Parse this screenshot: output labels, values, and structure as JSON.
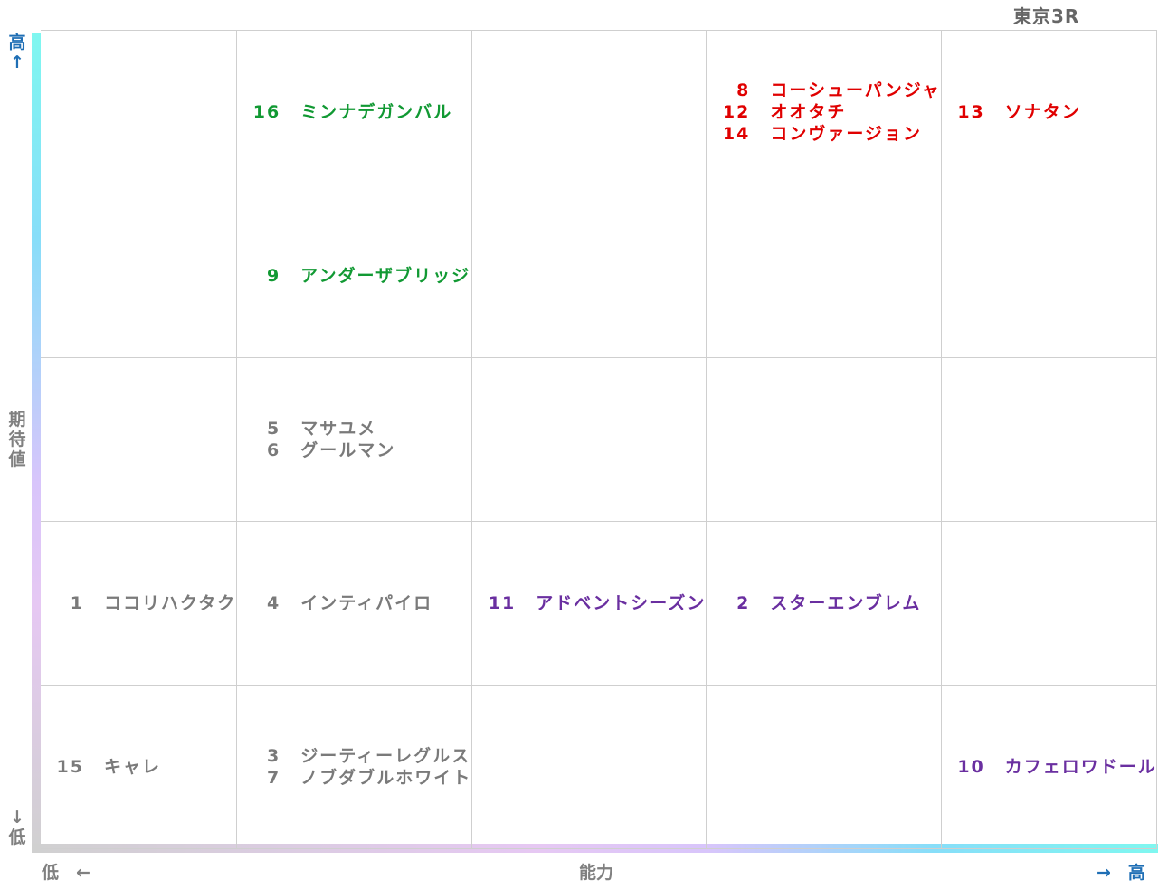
{
  "title": "東京3R",
  "colors": {
    "high": "#e00000",
    "green": "#119933",
    "gray": "#7a7a7a",
    "purple": "#6a2fa0"
  },
  "axes": {
    "y_label": "期\n待\n値",
    "y_high": "高\n↑",
    "y_low": "↓\n低",
    "x_label": "能力",
    "x_low": "低　←",
    "x_high": "→　高"
  },
  "chart_data": {
    "type": "table",
    "title": "東京3R",
    "xlabel": "能力",
    "ylabel": "期待値",
    "rows": 5,
    "cols": 5,
    "cells": [
      {
        "row": 0,
        "col": 1,
        "color": "green",
        "entries": [
          {
            "num": "16",
            "name": "ミンナデガンバル"
          }
        ]
      },
      {
        "row": 0,
        "col": 3,
        "color": "high",
        "entries": [
          {
            "num": "8",
            "name": "コーシューパンジャ"
          },
          {
            "num": "12",
            "name": "オオタチ"
          },
          {
            "num": "14",
            "name": "コンヴァージョン"
          }
        ]
      },
      {
        "row": 0,
        "col": 4,
        "color": "high",
        "entries": [
          {
            "num": "13",
            "name": "ソナタン"
          }
        ]
      },
      {
        "row": 1,
        "col": 1,
        "color": "green",
        "entries": [
          {
            "num": "9",
            "name": "アンダーザブリッジ"
          }
        ]
      },
      {
        "row": 2,
        "col": 1,
        "color": "gray",
        "entries": [
          {
            "num": "5",
            "name": "マサユメ"
          },
          {
            "num": "6",
            "name": "グールマン"
          }
        ]
      },
      {
        "row": 3,
        "col": 0,
        "color": "gray",
        "entries": [
          {
            "num": "1",
            "name": "ココリハクタク"
          }
        ]
      },
      {
        "row": 3,
        "col": 1,
        "color": "gray",
        "entries": [
          {
            "num": "4",
            "name": "インティパイロ"
          }
        ]
      },
      {
        "row": 3,
        "col": 2,
        "color": "purple",
        "entries": [
          {
            "num": "11",
            "name": "アドベントシーズン"
          }
        ]
      },
      {
        "row": 3,
        "col": 3,
        "color": "purple",
        "entries": [
          {
            "num": "2",
            "name": "スターエンブレム"
          }
        ]
      },
      {
        "row": 4,
        "col": 0,
        "color": "gray",
        "entries": [
          {
            "num": "15",
            "name": "キャレ"
          }
        ]
      },
      {
        "row": 4,
        "col": 1,
        "color": "gray",
        "entries": [
          {
            "num": "3",
            "name": "ジーティーレグルス"
          },
          {
            "num": "7",
            "name": "ノブダブルホワイト"
          }
        ]
      },
      {
        "row": 4,
        "col": 4,
        "color": "purple",
        "entries": [
          {
            "num": "10",
            "name": "カフェロワドール"
          }
        ]
      }
    ]
  }
}
